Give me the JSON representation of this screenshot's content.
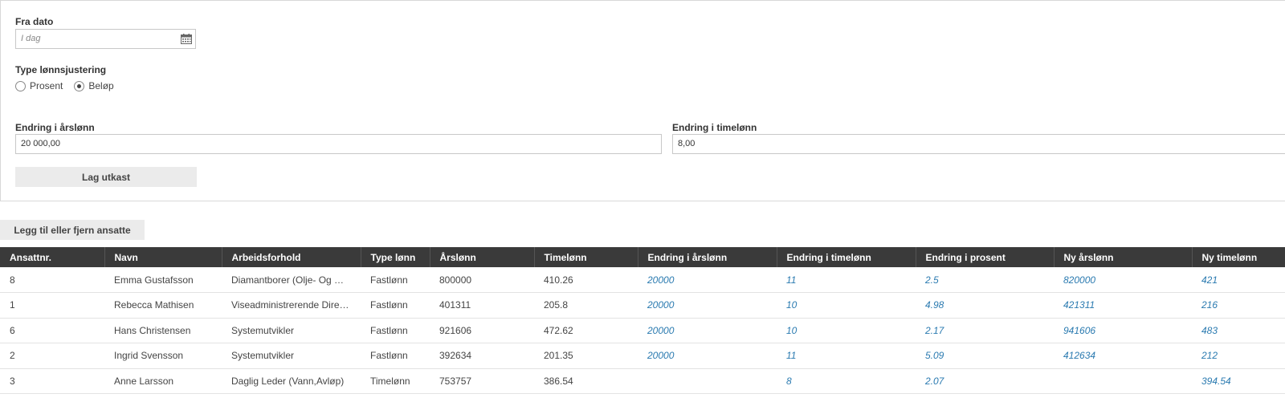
{
  "form": {
    "fra_dato_label": "Fra dato",
    "fra_dato_placeholder": "I dag",
    "type_label": "Type lønnsjustering",
    "radio_prosent": "Prosent",
    "radio_belop": "Beløp",
    "selected_type": "Beløp",
    "endring_arslonn_label": "Endring i årslønn",
    "endring_arslonn_value": "20 000,00",
    "endring_timelonn_label": "Endring i timelønn",
    "endring_timelonn_value": "8,00",
    "lag_utkast_label": "Lag utkast"
  },
  "legg_til_label": "Legg til eller fjern ansatte",
  "table": {
    "headers": [
      "Ansattnr.",
      "Navn",
      "Arbeidsforhold",
      "Type lønn",
      "Årslønn",
      "Timelønn",
      "Endring i årslønn",
      "Endring i timelønn",
      "Endring i prosent",
      "Ny årslønn",
      "Ny timelønn"
    ],
    "rows": [
      [
        "8",
        "Emma Gustafsson",
        "Diamantborer (Olje- Og Gass…",
        "Fastlønn",
        "800000",
        "410.26",
        "20000",
        "11",
        "2.5",
        "820000",
        "421"
      ],
      [
        "1",
        "Rebecca Mathisen",
        "Viseadministrerende Direktør",
        "Fastlønn",
        "401311",
        "205.8",
        "20000",
        "10",
        "4.98",
        "421311",
        "216"
      ],
      [
        "6",
        "Hans Christensen",
        "Systemutvikler",
        "Fastlønn",
        "921606",
        "472.62",
        "20000",
        "10",
        "2.17",
        "941606",
        "483"
      ],
      [
        "2",
        "Ingrid Svensson",
        "Systemutvikler",
        "Fastlønn",
        "392634",
        "201.35",
        "20000",
        "11",
        "5.09",
        "412634",
        "212"
      ],
      [
        "3",
        "Anne Larsson",
        "Daglig Leder (Vann,Avløp)",
        "Timelønn",
        "753757",
        "386.54",
        "",
        "8",
        "2.07",
        "",
        "394.54"
      ]
    ]
  }
}
